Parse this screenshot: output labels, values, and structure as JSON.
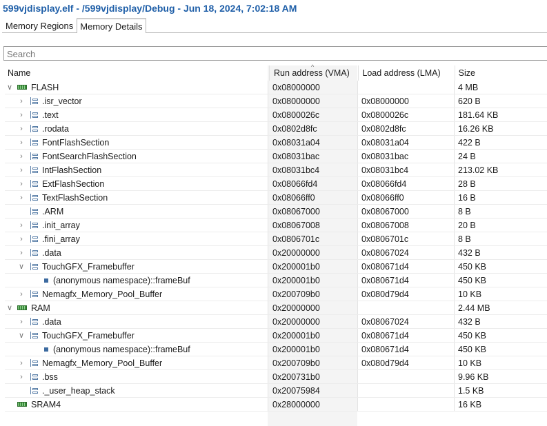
{
  "title": "599vjdisplay.elf - /599vjdisplay/Debug - Jun 18, 2024, 7:02:18 AM",
  "tabs": [
    "Memory Regions",
    "Memory Details"
  ],
  "search_placeholder": "Search",
  "columns": [
    "Name",
    "Run address (VMA)",
    "Load address (LMA)",
    "Size"
  ],
  "rows": [
    {
      "level": 0,
      "expander": "expanded",
      "icon": "memory",
      "name": "FLASH",
      "vma": "0x08000000",
      "lma": "",
      "size": "4 MB"
    },
    {
      "level": 1,
      "expander": "collapsed",
      "icon": "section",
      "name": ".isr_vector",
      "vma": "0x08000000",
      "lma": "0x08000000",
      "size": "620 B"
    },
    {
      "level": 1,
      "expander": "collapsed",
      "icon": "section",
      "name": ".text",
      "vma": "0x0800026c",
      "lma": "0x0800026c",
      "size": "181.64 KB"
    },
    {
      "level": 1,
      "expander": "collapsed",
      "icon": "section",
      "name": ".rodata",
      "vma": "0x0802d8fc",
      "lma": "0x0802d8fc",
      "size": "16.26 KB"
    },
    {
      "level": 1,
      "expander": "collapsed",
      "icon": "section",
      "name": "FontFlashSection",
      "vma": "0x08031a04",
      "lma": "0x08031a04",
      "size": "422 B"
    },
    {
      "level": 1,
      "expander": "collapsed",
      "icon": "section",
      "name": "FontSearchFlashSection",
      "vma": "0x08031bac",
      "lma": "0x08031bac",
      "size": "24 B"
    },
    {
      "level": 1,
      "expander": "collapsed",
      "icon": "section",
      "name": "IntFlashSection",
      "vma": "0x08031bc4",
      "lma": "0x08031bc4",
      "size": "213.02 KB"
    },
    {
      "level": 1,
      "expander": "collapsed",
      "icon": "section",
      "name": "ExtFlashSection",
      "vma": "0x08066fd4",
      "lma": "0x08066fd4",
      "size": "28 B"
    },
    {
      "level": 1,
      "expander": "collapsed",
      "icon": "section",
      "name": "TextFlashSection",
      "vma": "0x08066ff0",
      "lma": "0x08066ff0",
      "size": "16 B"
    },
    {
      "level": 1,
      "expander": "none",
      "icon": "section",
      "name": ".ARM",
      "vma": "0x08067000",
      "lma": "0x08067000",
      "size": "8 B"
    },
    {
      "level": 1,
      "expander": "collapsed",
      "icon": "section",
      "name": ".init_array",
      "vma": "0x08067008",
      "lma": "0x08067008",
      "size": "20 B"
    },
    {
      "level": 1,
      "expander": "collapsed",
      "icon": "section",
      "name": ".fini_array",
      "vma": "0x0806701c",
      "lma": "0x0806701c",
      "size": "8 B"
    },
    {
      "level": 1,
      "expander": "collapsed",
      "icon": "section",
      "name": ".data",
      "vma": "0x20000000",
      "lma": "0x08067024",
      "size": "432 B"
    },
    {
      "level": 1,
      "expander": "expanded",
      "icon": "section",
      "name": "TouchGFX_Framebuffer",
      "vma": "0x200001b0",
      "lma": "0x080671d4",
      "size": "450 KB"
    },
    {
      "level": 2,
      "expander": "none",
      "icon": "symbol",
      "name": "(anonymous namespace)::frameBuf",
      "vma": "0x200001b0",
      "lma": "0x080671d4",
      "size": "450 KB"
    },
    {
      "level": 1,
      "expander": "collapsed",
      "icon": "section",
      "name": "Nemagfx_Memory_Pool_Buffer",
      "vma": "0x200709b0",
      "lma": "0x080d79d4",
      "size": "10 KB"
    },
    {
      "level": 0,
      "expander": "expanded",
      "icon": "memory",
      "name": "RAM",
      "vma": "0x20000000",
      "lma": "",
      "size": "2.44 MB"
    },
    {
      "level": 1,
      "expander": "collapsed",
      "icon": "section",
      "name": ".data",
      "vma": "0x20000000",
      "lma": "0x08067024",
      "size": "432 B"
    },
    {
      "level": 1,
      "expander": "expanded",
      "icon": "section",
      "name": "TouchGFX_Framebuffer",
      "vma": "0x200001b0",
      "lma": "0x080671d4",
      "size": "450 KB"
    },
    {
      "level": 2,
      "expander": "none",
      "icon": "symbol",
      "name": "(anonymous namespace)::frameBuf",
      "vma": "0x200001b0",
      "lma": "0x080671d4",
      "size": "450 KB"
    },
    {
      "level": 1,
      "expander": "collapsed",
      "icon": "section",
      "name": "Nemagfx_Memory_Pool_Buffer",
      "vma": "0x200709b0",
      "lma": "0x080d79d4",
      "size": "10 KB"
    },
    {
      "level": 1,
      "expander": "collapsed",
      "icon": "section",
      "name": ".bss",
      "vma": "0x200731b0",
      "lma": "",
      "size": "9.96 KB"
    },
    {
      "level": 1,
      "expander": "none",
      "icon": "section",
      "name": "._user_heap_stack",
      "vma": "0x20075984",
      "lma": "",
      "size": "1.5 KB"
    },
    {
      "level": 0,
      "expander": "none",
      "icon": "memory",
      "name": "SRAM4",
      "vma": "0x28000000",
      "lma": "",
      "size": "16 KB"
    }
  ]
}
